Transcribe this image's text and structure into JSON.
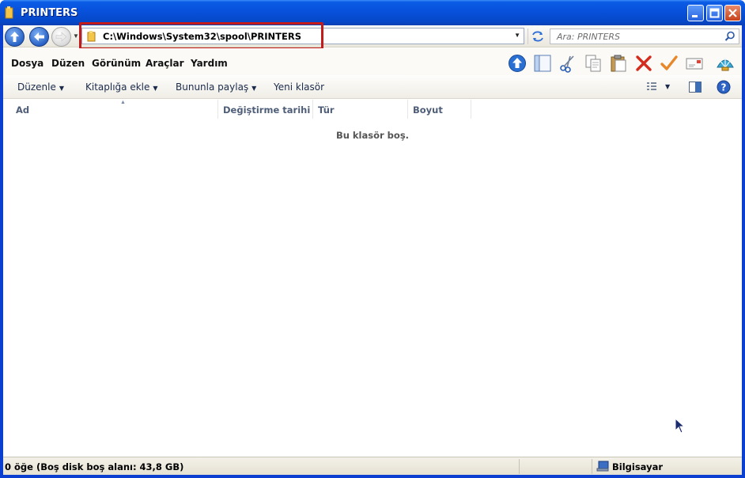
{
  "window": {
    "title": "PRINTERS"
  },
  "address": {
    "path": "C:\\Windows\\System32\\spool\\PRINTERS",
    "search_placeholder": "Ara: PRINTERS"
  },
  "menu": {
    "items": [
      {
        "label": "Dosya"
      },
      {
        "label": "Düzen"
      },
      {
        "label": "Görünüm"
      },
      {
        "label": "Araçlar"
      },
      {
        "label": "Yardım"
      }
    ]
  },
  "commands": {
    "organize": "Düzenle",
    "add_to_library": "Kitaplığa ekle",
    "share_with": "Bununla paylaş",
    "new_folder": "Yeni klasör"
  },
  "columns": [
    "Ad",
    "Değiştirme tarihi",
    "Tür",
    "Boyut"
  ],
  "content": {
    "empty_message": "Bu klasör boş."
  },
  "status": {
    "left": "0 öğe (Boş disk boş alanı: 43,8 GB)",
    "right": "Bilgisayar"
  },
  "colors": {
    "titlebar": "#0852dd",
    "highlight": "#c41a1a"
  },
  "toolbar_icons": [
    "up-icon",
    "pane-icon",
    "cut-icon",
    "copy-icon",
    "paste-icon",
    "delete-icon",
    "check-icon",
    "email-icon",
    "shell-icon"
  ]
}
